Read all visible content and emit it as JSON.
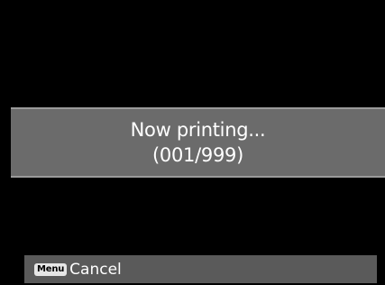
{
  "dialog": {
    "line1": "Now printing...",
    "line2": "(001/999)"
  },
  "footer": {
    "key_label": "Menu",
    "action_label": "Cancel"
  },
  "colors": {
    "background": "#000000",
    "band": "#6b6b6b",
    "band_border": "#9a9a9a",
    "footer": "#5a5a5a",
    "text": "#ffffff"
  }
}
